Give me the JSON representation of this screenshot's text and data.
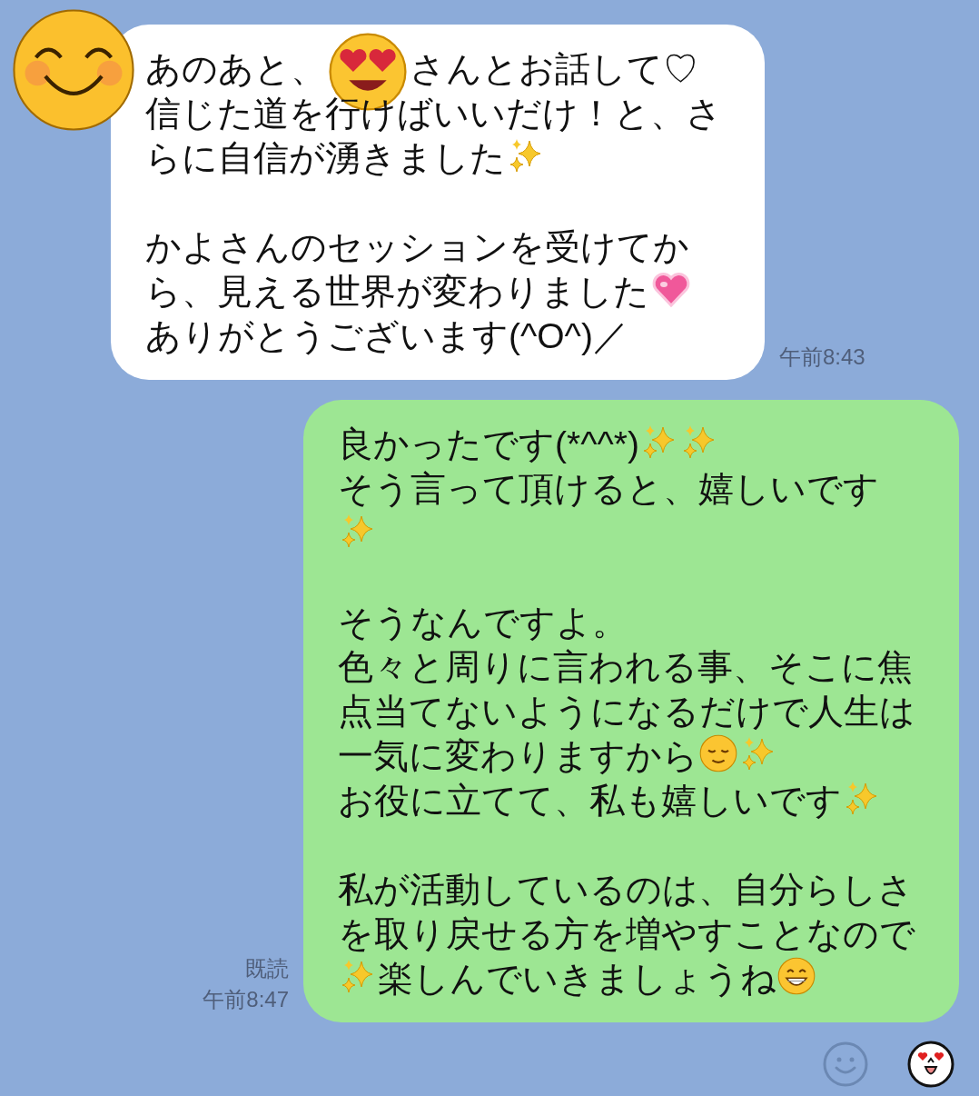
{
  "messages": [
    {
      "kind": "incoming",
      "paragraphs": [
        [
          [
            "あのあと、",
            {
              "kind": "heart_eyes"
            },
            "さんとお話して♡"
          ],
          [
            "信じた道を行けばいいだけ！と、さ"
          ],
          [
            "らに自信が湧きました",
            {
              "kind": "sparkles"
            }
          ]
        ],
        [
          [
            "かよさんのセッションを受けてか"
          ],
          [
            "ら、見える世界が変わりました",
            {
              "kind": "heart"
            }
          ],
          [
            "ありがとうございます(^O^)／"
          ]
        ]
      ],
      "time": "午前8:43"
    },
    {
      "kind": "outgoing",
      "paragraphs": [
        [
          [
            "良かったです(*^^*)",
            {
              "kind": "sparkles"
            },
            {
              "kind": "sparkles"
            }
          ],
          [
            "そう言って頂けると、嬉しいです"
          ],
          [
            {
              "kind": "sparkles"
            }
          ]
        ],
        [
          [
            "そうなんですよ。"
          ],
          [
            "色々と周りに言われる事、そこに焦"
          ],
          [
            "点当てないようになるだけで人生は"
          ],
          [
            "一気に変わりますから",
            {
              "kind": "relieved"
            },
            {
              "kind": "sparkles"
            }
          ],
          [
            "お役に立てて、私も嬉しいです",
            {
              "kind": "sparkles"
            }
          ]
        ],
        [
          [
            "私が活動しているのは、自分らしさ"
          ],
          [
            "を取り戻せる方を増やすことなので"
          ],
          [
            {
              "kind": "sparkles"
            },
            "楽しんでいきましょうね",
            {
              "kind": "grin"
            }
          ]
        ]
      ],
      "read": "既読",
      "time": "午前8:47"
    }
  ]
}
